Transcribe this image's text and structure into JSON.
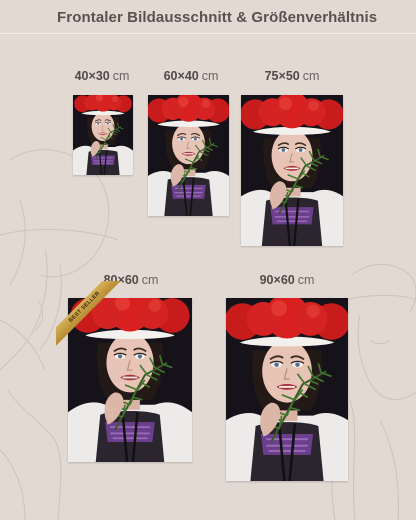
{
  "page": {
    "title": "Frontaler Bildausschnitt & Größenverhältnis",
    "unit": "cm"
  },
  "sizes": [
    {
      "dimensions": "40×30",
      "unit": "cm"
    },
    {
      "dimensions": "60×40",
      "unit": "cm"
    },
    {
      "dimensions": "75×50",
      "unit": "cm"
    },
    {
      "dimensions": "80×60",
      "unit": "cm",
      "badge": "BEST SELLER"
    },
    {
      "dimensions": "90×60",
      "unit": "cm"
    }
  ],
  "colors": {
    "background": "#e2d9d3",
    "title_text": "#59524f",
    "hat_red": "#d91e1e",
    "badge_gold": "#c9a24a"
  },
  "icons": [
    "best-seller-ribbon"
  ]
}
